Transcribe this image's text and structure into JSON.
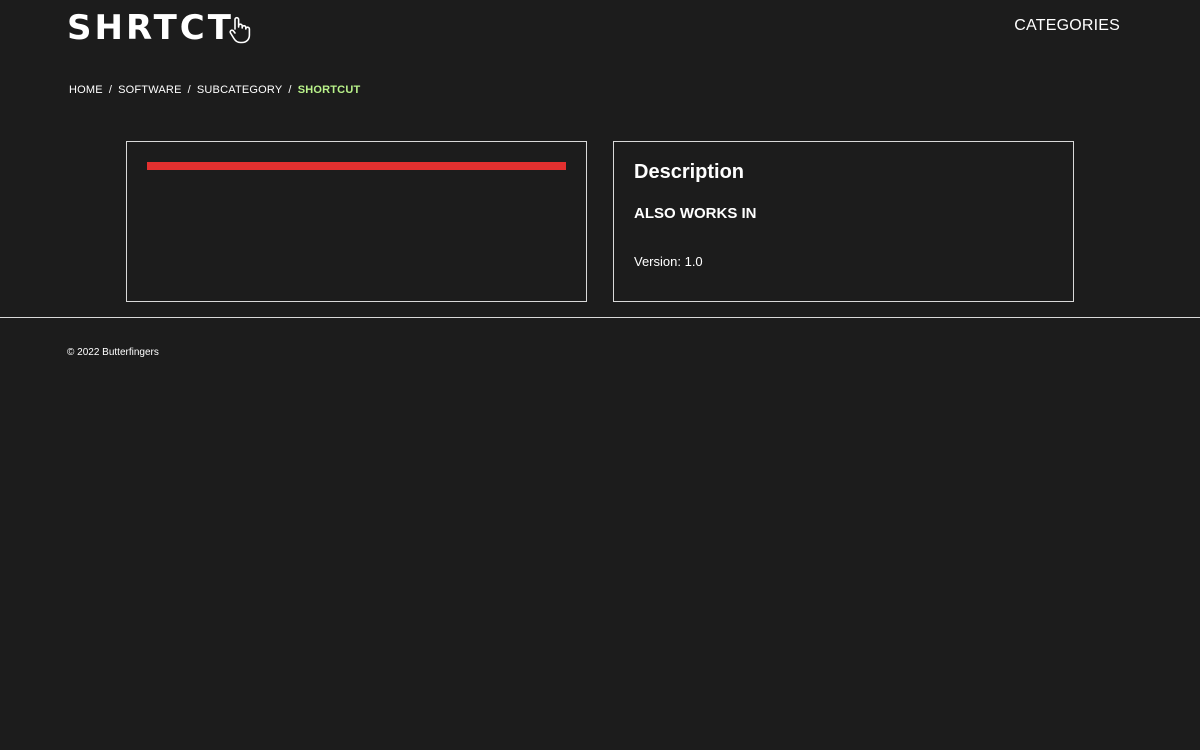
{
  "header": {
    "logo_text": "SHRTCT",
    "logo_icon": "hand-pointer-icon",
    "nav_label": "CATEGORIES"
  },
  "breadcrumb": {
    "items": [
      "HOME",
      "SOFTWARE",
      "SUBCATEGORY"
    ],
    "separator": "/",
    "current": "SHORTCUT"
  },
  "left_panel": {
    "bar_color": "#e3302f"
  },
  "right_panel": {
    "title": "Description",
    "also_works_in": "ALSO WORKS IN",
    "version": "Version: 1.0"
  },
  "footer": {
    "copyright": "© 2022 Butterfingers"
  },
  "colors": {
    "background": "#1c1c1c",
    "accent_green": "#b9f28a",
    "accent_red": "#e3302f",
    "border": "#d9d9d9"
  }
}
